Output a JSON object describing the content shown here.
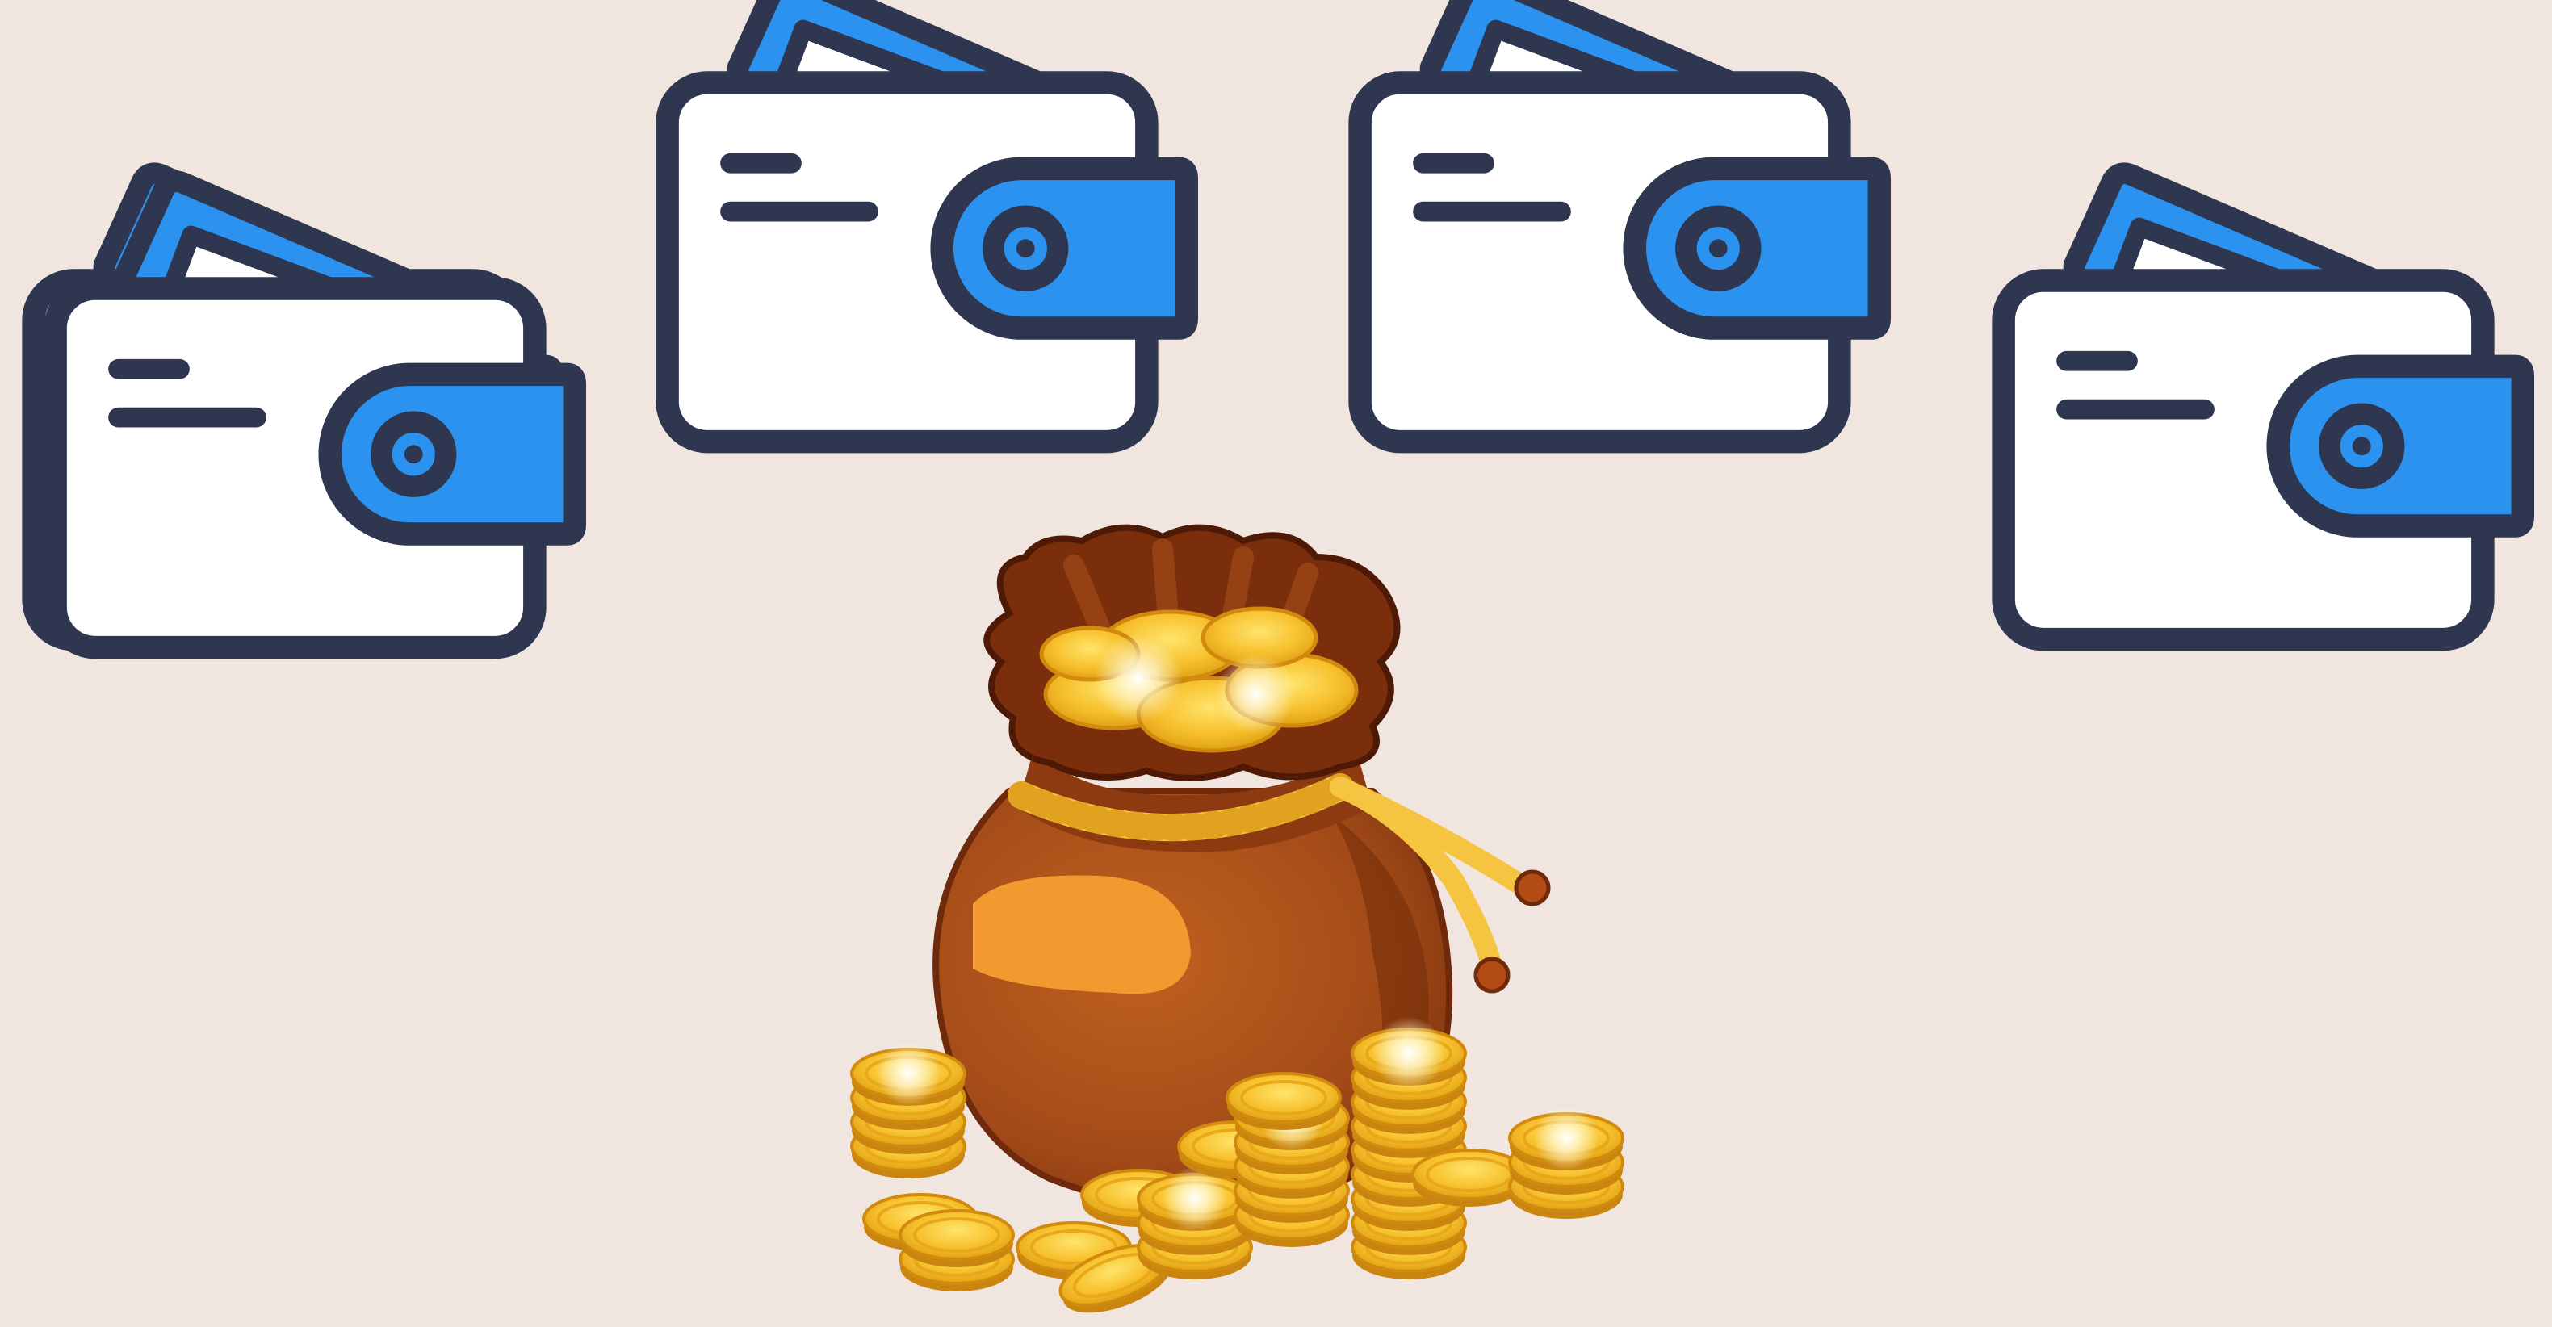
{
  "scene": {
    "background_color": "#F1E6DF",
    "wallets": [
      {
        "name": "wallet-left-stacked",
        "stacked": true
      },
      {
        "name": "wallet-top-center-left",
        "stacked": false
      },
      {
        "name": "wallet-top-center-right",
        "stacked": false
      },
      {
        "name": "wallet-right",
        "stacked": false
      }
    ],
    "icons": [
      "wallet-icon",
      "money-bag-icon",
      "gold-coin-icon"
    ],
    "colors": {
      "outline": "#2E3650",
      "wallet_body": "#FFFFFF",
      "wallet_accent": "#2B93EF",
      "bag_brown": "#A9501D",
      "bag_dark": "#6E2A0B",
      "bag_highlight": "#F29A30",
      "rope": "#F5C542",
      "coin_gold": "#F7C12E",
      "coin_dark": "#D18A0E",
      "coin_shine": "#FFF4C2"
    }
  }
}
